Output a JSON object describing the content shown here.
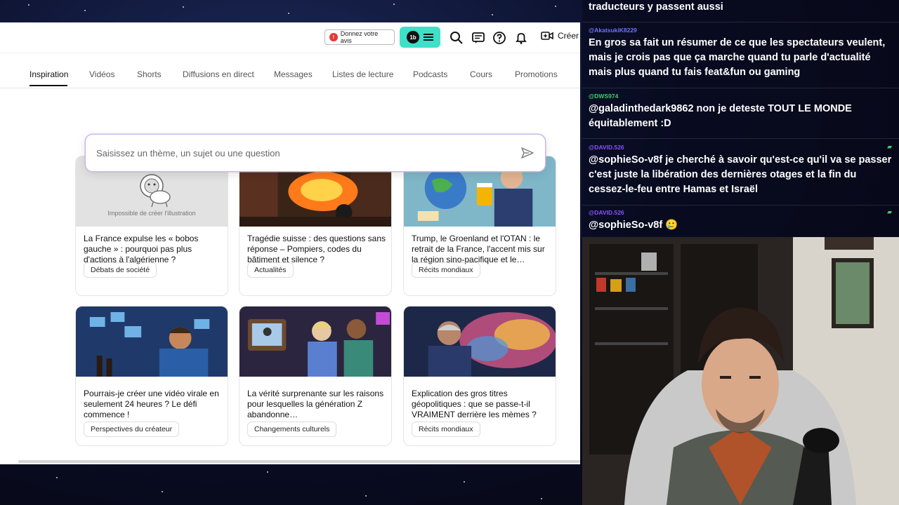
{
  "topbar": {
    "feedback_label": "Donnez votre avis",
    "menu_avatar_text": "1b",
    "create_label": "Créer"
  },
  "tabs": [
    {
      "label": "Inspiration",
      "active": true
    },
    {
      "label": "Vidéos"
    },
    {
      "label": "Shorts"
    },
    {
      "label": "Diffusions en direct"
    },
    {
      "label": "Messages"
    },
    {
      "label": "Listes de lecture"
    },
    {
      "label": "Podcasts"
    },
    {
      "label": "Cours"
    },
    {
      "label": "Promotions"
    }
  ],
  "search": {
    "placeholder": "Saisissez un thème, un sujet ou une question"
  },
  "cards": [
    {
      "title": "La France expulse les « bobos gauche » : pourquoi pas plus d'actions à l'algérienne ?",
      "chip": "Débats de société",
      "thumb_text": "Impossible de créer l'illustration"
    },
    {
      "title": "Tragédie suisse : des questions sans réponse – Pompiers, codes du bâtiment et silence ?",
      "chip": "Actualités"
    },
    {
      "title": "Trump, le Groenland et l'OTAN : le retrait de la France, l'accent mis sur la région sino-pacifique et le…",
      "chip": "Récits mondiaux"
    },
    {
      "title": "Pourrais-je créer une vidéo virale en seulement 24 heures ? Le défi commence !",
      "chip": "Perspectives du créateur"
    },
    {
      "title": "La vérité surprenante sur les raisons pour lesquelles la génération Z abandonne…",
      "chip": "Changements culturels"
    },
    {
      "title": "Explication des gros titres géopolitiques : que se passe-t-il VRAIMENT derrière les mèmes ?",
      "chip": "Récits mondiaux"
    }
  ],
  "chat": {
    "messages": [
      {
        "user": "",
        "text": "traducteurs y passent aussi"
      },
      {
        "user": "@AkatsukiK8229",
        "user_color": "#6f74ff",
        "text": "En gros sa fait un résumer de ce que les spectateurs veulent, mais je crois pas que ça marche quand tu parle d'actualité mais plus quand tu fais feat&fun ou gaming"
      },
      {
        "user": "@DWS974",
        "user_color": "#3fcf6a",
        "text": "@galadinthedark9862 non je deteste TOUT LE MONDE équitablement :D"
      },
      {
        "user": "@DAVID.526",
        "user_color": "#8a4fff",
        "text": "@sophieSo-v8f je cherché à savoir qu'est-ce qu'il va se passer c'est juste la libération des dernières otages et la fin du cessez-le-feu entre Hamas et Israël"
      },
      {
        "user": "@DAVID.526",
        "user_color": "#8a4fff",
        "text": "@sophieSo-v8f 🥲"
      }
    ]
  },
  "colors": {
    "accent_teal": "#3ee0c8",
    "feedback_red": "#e53935",
    "search_border": "#c9b6e8"
  }
}
